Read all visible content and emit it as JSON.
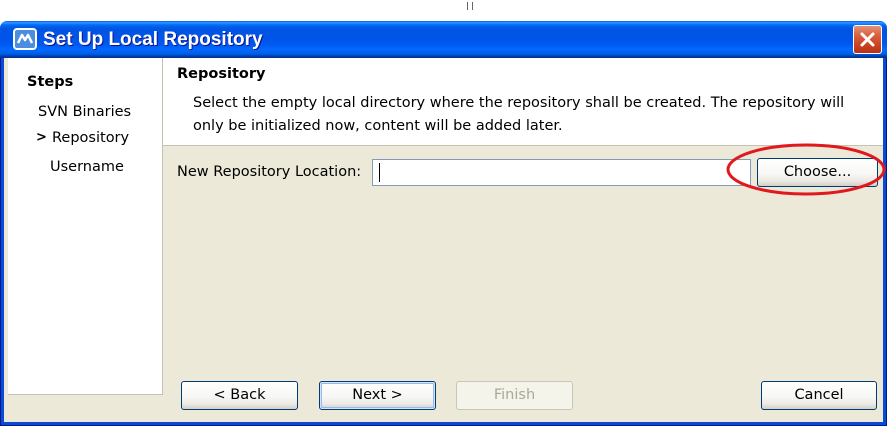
{
  "window": {
    "title": "Set Up Local Repository",
    "icon": "app-icon",
    "close_icon": "close-icon"
  },
  "steps": {
    "heading": "Steps",
    "current_marker": ">",
    "items": [
      {
        "label": "SVN Binaries",
        "current": false
      },
      {
        "label": "Repository",
        "current": true
      },
      {
        "label": "Username",
        "current": false
      }
    ]
  },
  "panel": {
    "title": "Repository",
    "description_lines": [
      "Select the empty local directory where the repository shall be created. The repository will",
      "only be initialized now, content will be added later."
    ]
  },
  "form": {
    "location_label": "New Repository Location:",
    "location_value": "",
    "choose_label": "Choose..."
  },
  "buttons": {
    "back": "< Back",
    "next": "Next >",
    "finish": "Finish",
    "finish_enabled": false,
    "cancel": "Cancel"
  },
  "colors": {
    "dialog_background": "#ECE9D8",
    "panel_background": "#FFFFFF",
    "title_bar": "#0054E3",
    "disabled_text": "#ACA899",
    "annotation": "#E0191E"
  }
}
